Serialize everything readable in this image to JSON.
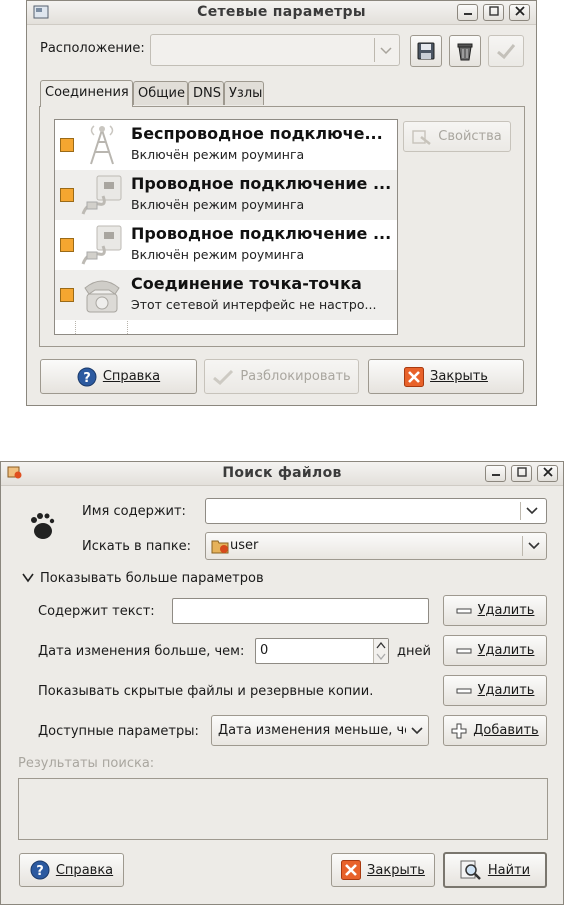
{
  "net_window": {
    "title": "Сетевые параметры",
    "location_label": "Расположение:",
    "tabs": [
      {
        "label": "Соединения"
      },
      {
        "label": "Общие"
      },
      {
        "label": "DNS"
      },
      {
        "label": "Узлы"
      }
    ],
    "connections": [
      {
        "name": "Беспроводное подключе...",
        "desc": "Включён режим роуминга",
        "icon": "wireless-tower-icon"
      },
      {
        "name": "Проводное подключение ...",
        "desc": "Включён режим роуминга",
        "icon": "ethernet-plug-icon"
      },
      {
        "name": "Проводное подключение ...",
        "desc": "Включён режим роуминга",
        "icon": "ethernet-plug-icon"
      },
      {
        "name": "Соединение точка-точка",
        "desc": "Этот сетевой интерфейс не настро...",
        "icon": "telephone-icon"
      }
    ],
    "properties_label": "Свойства",
    "help_label": "Справка",
    "unlock_label": "Разблокировать",
    "close_label": "Закрыть"
  },
  "search_window": {
    "title": "Поиск файлов",
    "name_contains_label": "Имя содержит:",
    "name_contains_value": "",
    "search_in_label": "Искать в папке:",
    "search_in_value": "user",
    "more_options_label": "Показывать больше параметров",
    "contains_text_label": "Содержит текст:",
    "contains_text_value": "",
    "remove_label": "Удалить",
    "date_modified_label": "Дата изменения больше, чем:",
    "date_modified_value": "0",
    "days_label": "дней",
    "hidden_files_label": "Показывать скрытые файлы и резервные копии.",
    "available_options_label": "Доступные параметры:",
    "available_options_value": "Дата изменения меньше, че",
    "add_label": "Добавить",
    "results_label": "Результаты поиска:",
    "help_label": "Справка",
    "close_label": "Закрыть",
    "find_label": "Найти"
  },
  "colors": {
    "window_bg": "#edebe7",
    "checkbox": "#f5a630",
    "close_icon": "#e8622a",
    "help_icon": "#2c5aa0"
  }
}
